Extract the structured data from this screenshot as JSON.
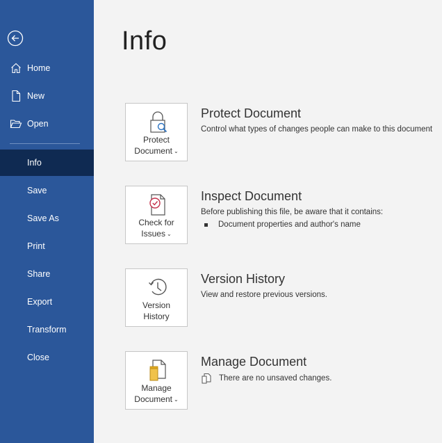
{
  "sidebar": {
    "items": [
      {
        "label": "Home"
      },
      {
        "label": "New"
      },
      {
        "label": "Open"
      },
      {
        "label": "Info"
      },
      {
        "label": "Save"
      },
      {
        "label": "Save As"
      },
      {
        "label": "Print"
      },
      {
        "label": "Share"
      },
      {
        "label": "Export"
      },
      {
        "label": "Transform"
      },
      {
        "label": "Close"
      }
    ]
  },
  "main": {
    "title": "Info",
    "sections": [
      {
        "button_line1": "Protect",
        "button_line2": "Document",
        "title": "Protect Document",
        "description": "Control what types of changes people can make to this document"
      },
      {
        "button_line1": "Check for",
        "button_line2": "Issues",
        "title": "Inspect Document",
        "description": "Before publishing this file, be aware that it contains:",
        "bullet": "Document properties and author's name"
      },
      {
        "button_line1": "Version",
        "button_line2": "History",
        "title": "Version History",
        "description": "View and restore previous versions."
      },
      {
        "button_line1": "Manage",
        "button_line2": "Document",
        "title": "Manage Document",
        "status": "There are no unsaved changes."
      }
    ]
  },
  "colors": {
    "sidebar_bg": "#2b579a",
    "sidebar_active": "#0f2a52",
    "page_bg": "#f3f3f3"
  }
}
